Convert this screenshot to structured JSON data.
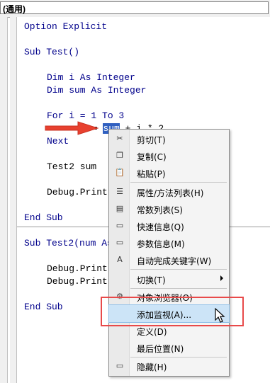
{
  "procedure_combo": {
    "value": "(通用)"
  },
  "code": {
    "line1": "Option Explicit",
    "line2": "Sub Test()",
    "line3": "Dim i As Integer",
    "line4": "Dim sum As Integer",
    "line5_a": "For i = 1 ",
    "line5_b": "To",
    "line5_c": " 3",
    "line6_a": "sum",
    "line6_b": " = ",
    "line6_c": "sum",
    "line6_d": " + i * 2",
    "line7": "Next",
    "line8": "Test2 sum",
    "line9": "Debug.Print",
    "line10": "End Sub",
    "line11": "Sub Test2(num As",
    "line12": "Debug.Print",
    "line13": "Debug.Print",
    "line14": "End Sub"
  },
  "menu": {
    "items": [
      {
        "label": "剪切(T)",
        "icon": "cut-icon"
      },
      {
        "label": "复制(C)",
        "icon": "copy-icon"
      },
      {
        "label": "粘贴(P)",
        "icon": "paste-icon"
      },
      {
        "label": "属性/方法列表(H)",
        "icon": "list-icon"
      },
      {
        "label": "常数列表(S)",
        "icon": "constants-icon"
      },
      {
        "label": "快速信息(Q)",
        "icon": "info-icon"
      },
      {
        "label": "参数信息(M)",
        "icon": "params-icon"
      },
      {
        "label": "自动完成关键字(W)",
        "icon": "autocomplete-icon"
      },
      {
        "label": "切换(T)",
        "icon": ""
      },
      {
        "label": "对象浏览器(O)",
        "icon": "object-browser-icon"
      },
      {
        "label": "添加监视(A)...",
        "icon": ""
      },
      {
        "label": "定义(D)",
        "icon": ""
      },
      {
        "label": "最后位置(N)",
        "icon": ""
      },
      {
        "label": "隐藏(H)",
        "icon": "hide-icon"
      }
    ]
  },
  "colors": {
    "keyword": "#00008b",
    "highlight_box": "#e84a4a",
    "arrow": "#e8412f",
    "menu_highlight": "#cce4f7"
  }
}
